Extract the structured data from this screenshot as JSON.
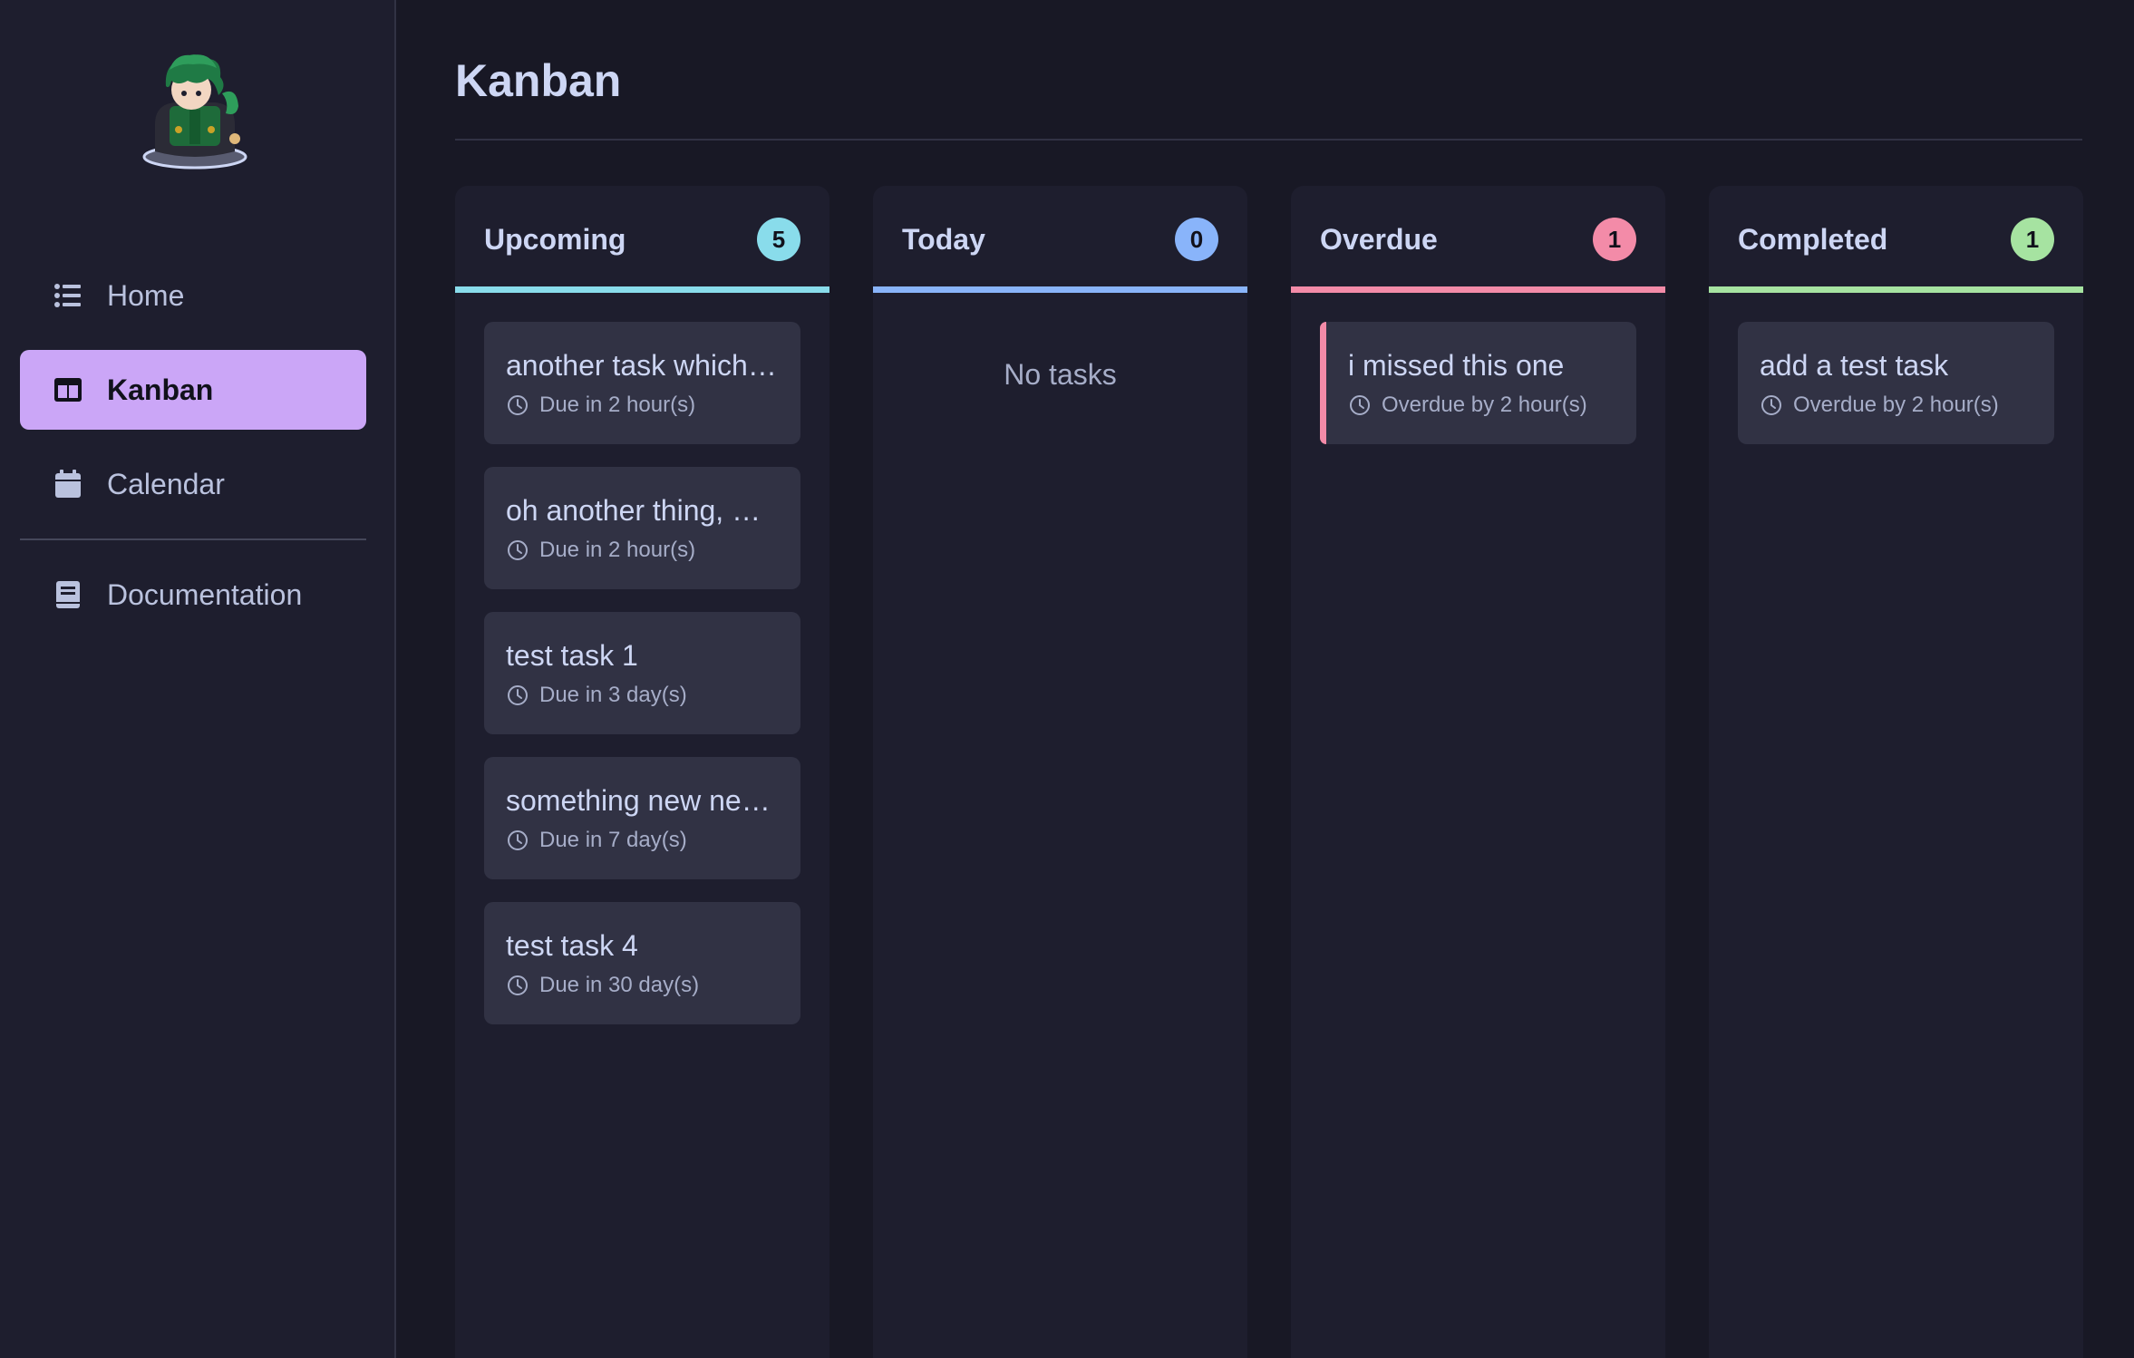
{
  "colors": {
    "upcoming": "#89dceb",
    "today": "#89b4fa",
    "overdue": "#f38ba8",
    "completed": "#a6e3a1",
    "accent": "#cba6f7"
  },
  "sidebar": {
    "items": [
      {
        "label": "Home",
        "icon": "list-icon"
      },
      {
        "label": "Kanban",
        "icon": "kanban-icon"
      },
      {
        "label": "Calendar",
        "icon": "calendar-icon"
      },
      {
        "label": "Documentation",
        "icon": "book-icon"
      }
    ]
  },
  "main": {
    "title": "Kanban",
    "columns": [
      {
        "title": "Upcoming",
        "count": "5",
        "tasks": [
          {
            "title": "another task which…",
            "meta": "Due in 2 hour(s)"
          },
          {
            "title": "oh another thing, …",
            "meta": "Due in 2 hour(s)"
          },
          {
            "title": "test task 1",
            "meta": "Due in 3 day(s)"
          },
          {
            "title": "something new ne…",
            "meta": "Due in 7 day(s)"
          },
          {
            "title": "test task 4",
            "meta": "Due in 30 day(s)"
          }
        ]
      },
      {
        "title": "Today",
        "count": "0",
        "empty": "No tasks"
      },
      {
        "title": "Overdue",
        "count": "1",
        "tasks": [
          {
            "title": "i missed this one",
            "meta": "Overdue by 2 hour(s)"
          }
        ]
      },
      {
        "title": "Completed",
        "count": "1",
        "tasks": [
          {
            "title": "add a test task",
            "meta": "Overdue by 2 hour(s)"
          }
        ]
      }
    ]
  }
}
